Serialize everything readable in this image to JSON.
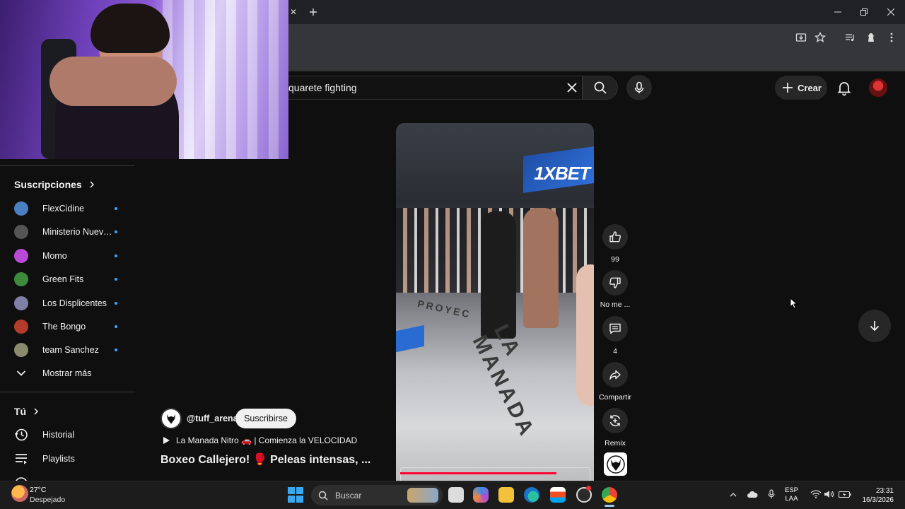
{
  "browser": {
    "new_tab_icon": "plus-icon",
    "close_tab_icon": "close-icon",
    "window_controls": [
      "minimize-icon",
      "restore-icon",
      "close-icon"
    ],
    "toolbar_icons": [
      "install-app-icon",
      "star-icon",
      "media-control-icon",
      "extension-icon",
      "more-vert-icon"
    ]
  },
  "youtube": {
    "search": {
      "query": "quarete fighting"
    },
    "create_label": "Crear",
    "accent": "#ff0033"
  },
  "sidebar": {
    "subscriptions_title": "Suscripciones",
    "subscriptions": [
      {
        "name": "FlexCidine",
        "color": "#4a7fc1"
      },
      {
        "name": "Ministerio Nueva...",
        "color": "#555555"
      },
      {
        "name": "Momo",
        "color": "#b84ad6"
      },
      {
        "name": "Green Fits",
        "color": "#3d8a3d"
      },
      {
        "name": "Los Displicentes",
        "color": "#7f7fa8"
      },
      {
        "name": "The Bongo",
        "color": "#b23b2a"
      },
      {
        "name": "team Sanchez",
        "color": "#8a8a6e"
      }
    ],
    "show_more": "Mostrar más",
    "you_title": "Tú",
    "you_items": [
      {
        "label": "Historial",
        "icon": "history-icon"
      },
      {
        "label": "Playlists",
        "icon": "playlist-icon"
      }
    ]
  },
  "short": {
    "banner_text": "1XBET",
    "ring_text": "LA MANADA",
    "floor_text": "PROYEC",
    "channel_handle": "@tuff_arena",
    "subscribe_label": "Suscribirse",
    "music": "La Manada Nitro 🚗 | Comienza la VELOCIDAD",
    "title": "Boxeo Callejero! 🥊 Peleas intensas, ...",
    "progress": 0.82,
    "actions": {
      "likes": "99",
      "dislike_label": "No me ...",
      "comments": "4",
      "share_label": "Compartir",
      "remix_label": "Remix"
    }
  },
  "taskbar": {
    "weather_temp": "27°C",
    "weather_desc": "Despejado",
    "search_placeholder": "Buscar",
    "lang_line1": "ESP",
    "lang_line2": "LAA",
    "time": "23:31",
    "date": "16/3/2026"
  }
}
